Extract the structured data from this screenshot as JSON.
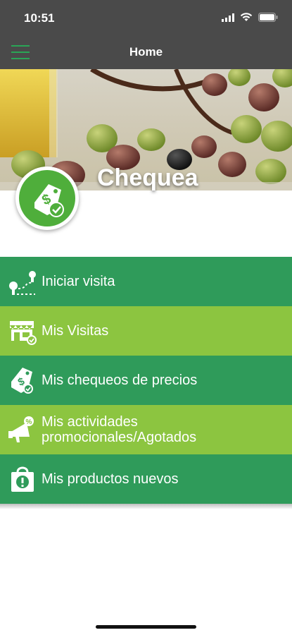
{
  "status_bar": {
    "time": "10:51"
  },
  "nav": {
    "title": "Home"
  },
  "hero": {
    "brand": "Chequea"
  },
  "menu": [
    {
      "label": "Iniciar visita",
      "icon": "map-route-icon",
      "style": "dark"
    },
    {
      "label": "Mis Visitas",
      "icon": "store-icon",
      "style": "light"
    },
    {
      "label": "Mis chequeos de precios",
      "icon": "price-tag-icon",
      "style": "dark"
    },
    {
      "label": "Mis actividades promocionales/Agotados",
      "icon": "megaphone-icon",
      "style": "light"
    },
    {
      "label": "Mis productos nuevos",
      "icon": "shopping-bag-icon",
      "style": "dark"
    }
  ],
  "colors": {
    "dark_green": "#2f9b5a",
    "light_green": "#8cc540",
    "bar": "#4a4a4a",
    "accent": "#2aa556"
  }
}
